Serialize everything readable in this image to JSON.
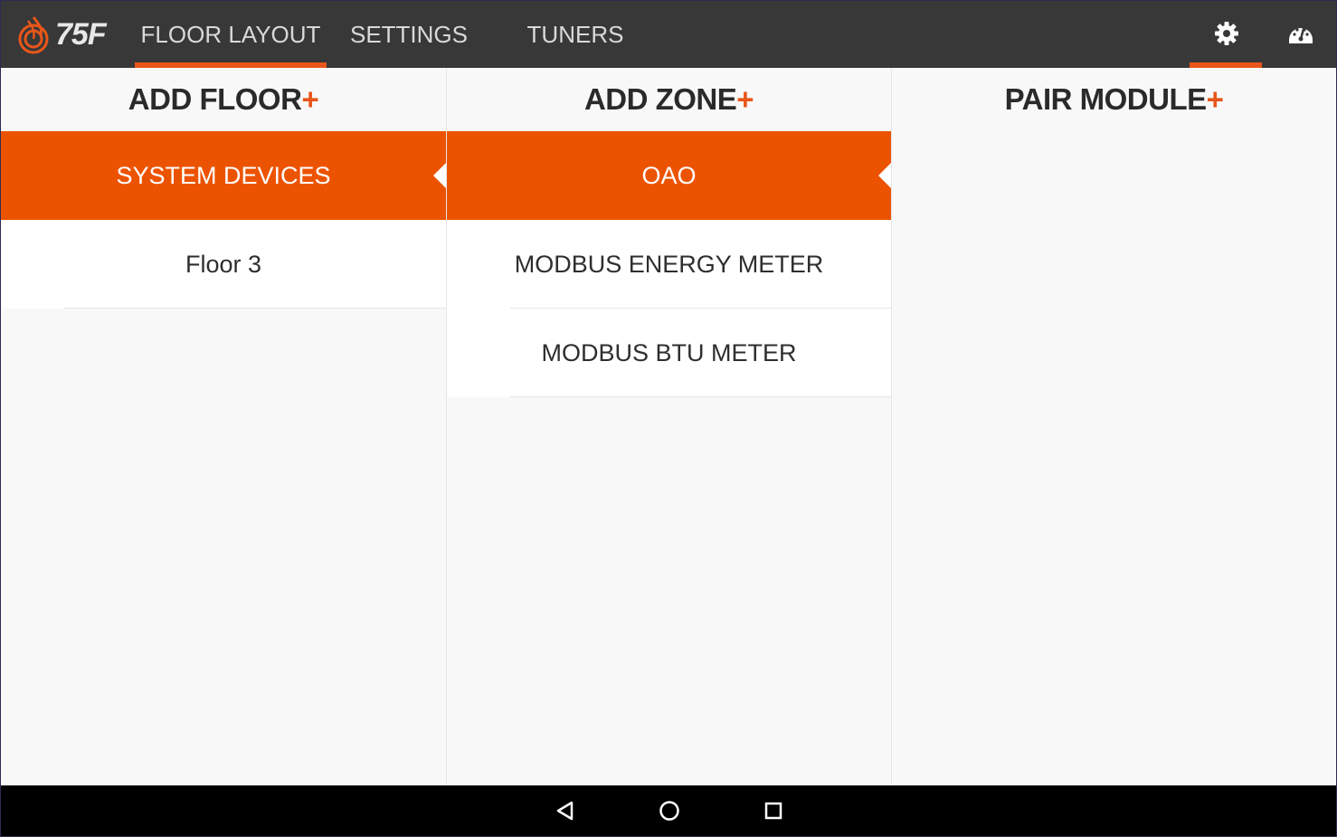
{
  "app": {
    "logo_text": "75F",
    "tabs": [
      {
        "label": "FLOOR LAYOUT",
        "active": true
      },
      {
        "label": "SETTINGS",
        "active": false
      },
      {
        "label": "TUNERS",
        "active": false
      }
    ],
    "icons": [
      "settings-gear-icon",
      "dashboard-gauge-icon"
    ]
  },
  "columns": {
    "floor": {
      "title": "ADD FLOOR",
      "plus": "+",
      "items": [
        {
          "label": "SYSTEM DEVICES",
          "selected": true
        },
        {
          "label": "Floor 3",
          "selected": false
        }
      ]
    },
    "zone": {
      "title": "ADD ZONE",
      "plus": "+",
      "items": [
        {
          "label": "OAO",
          "selected": true
        },
        {
          "label": "MODBUS ENERGY METER",
          "selected": false
        },
        {
          "label": "MODBUS BTU METER",
          "selected": false
        }
      ]
    },
    "module": {
      "title": "PAIR MODULE",
      "plus": "+"
    }
  },
  "colors": {
    "accent": "#e8561a",
    "selected_row": "#ec5300",
    "topbar": "#383838"
  },
  "navbar": [
    "back-icon",
    "home-icon",
    "recents-icon"
  ]
}
